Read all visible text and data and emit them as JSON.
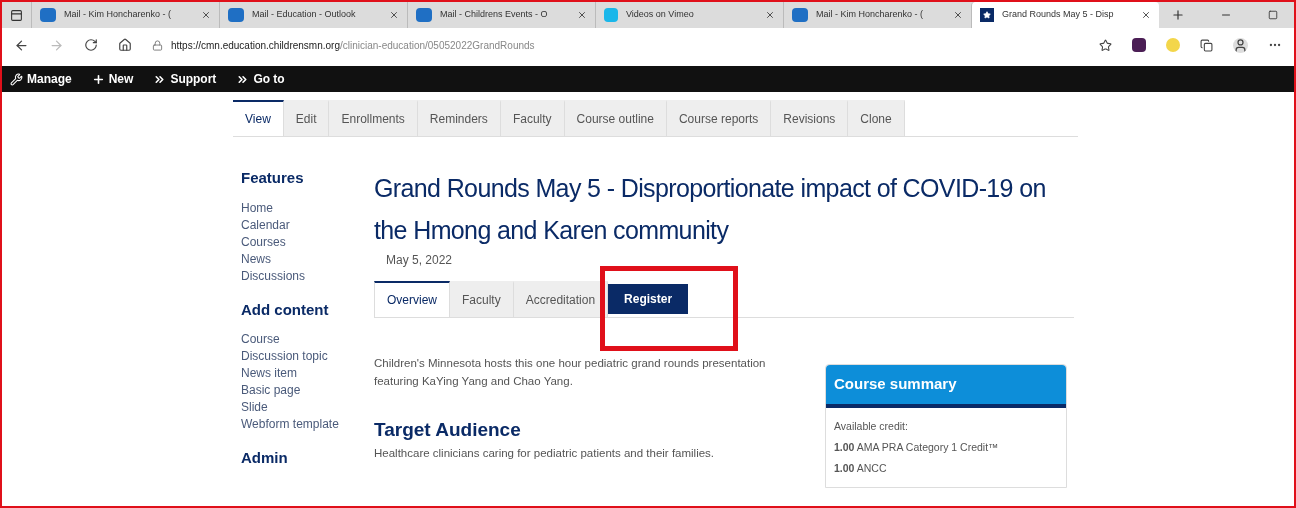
{
  "browser": {
    "tabs": [
      {
        "title": "Mail - Kim Honcharenko - (",
        "kind": "mail",
        "selected": false
      },
      {
        "title": "Mail - Education - Outlook",
        "kind": "mail",
        "selected": false
      },
      {
        "title": "Mail - Childrens Events - O",
        "kind": "mail",
        "selected": false
      },
      {
        "title": "Videos on Vimeo",
        "kind": "video",
        "selected": false
      },
      {
        "title": "Mail - Kim Honcharenko - (",
        "kind": "mail",
        "selected": false
      },
      {
        "title": "Grand Rounds May 5 - Disp",
        "kind": "star",
        "selected": true
      }
    ],
    "url_host": "https://cmn.education.childrensmn.org",
    "url_path": "/clinician-education/05052022GrandRounds"
  },
  "admin_toolbar": [
    {
      "label": "Manage",
      "kind": "wrench"
    },
    {
      "label": "New",
      "kind": "plus"
    },
    {
      "label": "Support",
      "kind": "chevrons"
    },
    {
      "label": "Go to",
      "kind": "chevrons"
    }
  ],
  "admin_tabs": [
    {
      "label": "View",
      "selected": true
    },
    {
      "label": "Edit",
      "selected": false
    },
    {
      "label": "Enrollments",
      "selected": false
    },
    {
      "label": "Reminders",
      "selected": false
    },
    {
      "label": "Faculty",
      "selected": false
    },
    {
      "label": "Course outline",
      "selected": false
    },
    {
      "label": "Course reports",
      "selected": false
    },
    {
      "label": "Revisions",
      "selected": false
    },
    {
      "label": "Clone",
      "selected": false
    }
  ],
  "sidebar": [
    {
      "heading": "Features",
      "items": [
        "Home",
        "Calendar",
        "Courses",
        "News",
        "Discussions"
      ]
    },
    {
      "heading": "Add content",
      "items": [
        "Course",
        "Discussion topic",
        "News item",
        "Basic page",
        "Slide",
        "Webform template"
      ]
    },
    {
      "heading": "Admin"
    }
  ],
  "page": {
    "title": "Grand Rounds May 5 - Disproportionate impact of COVID-19 on the Hmong and Karen community",
    "date": "May 5, 2022",
    "tabs": [
      {
        "label": "Overview",
        "selected": true,
        "kind": "tab"
      },
      {
        "label": "Faculty",
        "selected": false,
        "kind": "tab"
      },
      {
        "label": "Accreditation",
        "selected": false,
        "kind": "tab"
      },
      {
        "label": "Register",
        "kind": "button"
      }
    ],
    "intro": "Children's Minnesota hosts this one hour pediatric grand rounds presentation featuring KaYing Yang and Chao Yang.",
    "section_heading": "Target Audience",
    "section_text": "Healthcare clinicians caring for pediatric patients and their families."
  },
  "course_summary": {
    "title": "Course summary",
    "label": "Available credit:",
    "credits": [
      "**1.00** AMA PRA Category 1 Credit™",
      "**1.00** ANCC"
    ]
  }
}
